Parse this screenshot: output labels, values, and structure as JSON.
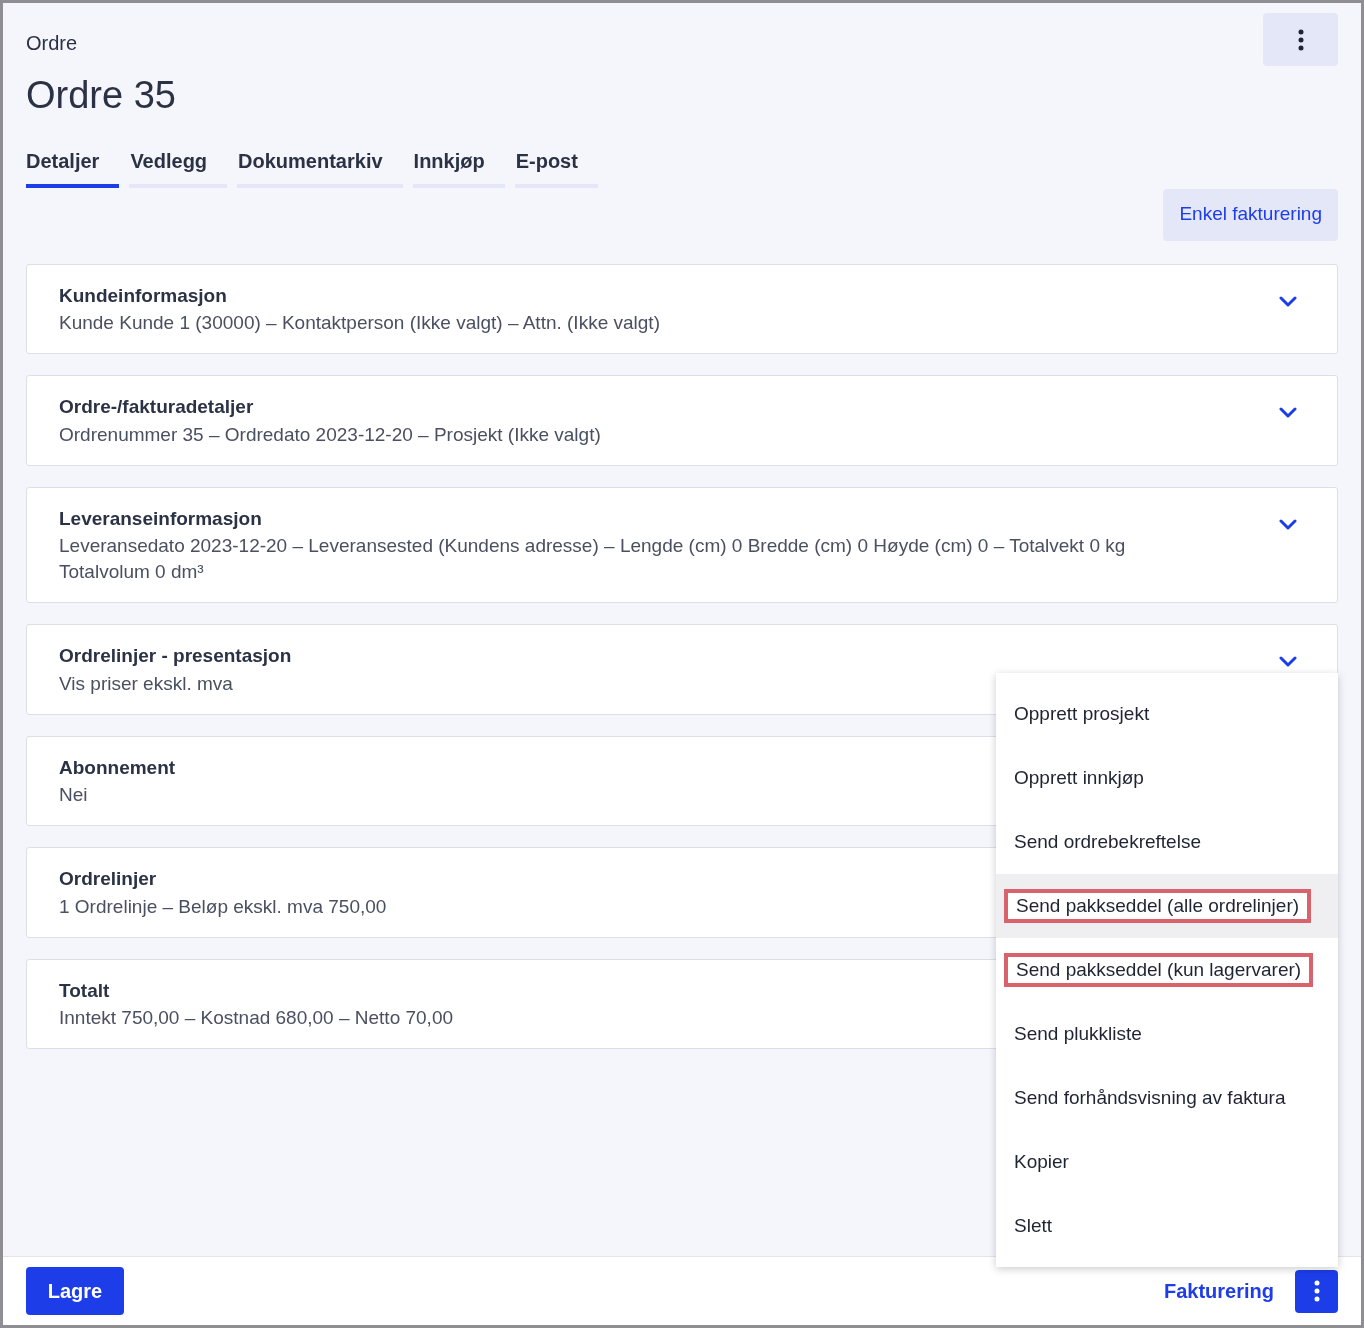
{
  "header": {
    "breadcrumb": "Ordre",
    "title": "Ordre 35"
  },
  "tabs": [
    {
      "label": "Detaljer",
      "selected": true
    },
    {
      "label": "Vedlegg",
      "selected": false
    },
    {
      "label": "Dokumentarkiv",
      "selected": false
    },
    {
      "label": "Innkjøp",
      "selected": false
    },
    {
      "label": "E-post",
      "selected": false
    }
  ],
  "quick_button": "Enkel fakturering",
  "sections": [
    {
      "title": "Kundeinformasjon",
      "summary": "Kunde Kunde 1 (30000) – Kontaktperson (Ikke valgt) – Attn. (Ikke valgt)",
      "expand_icon": true
    },
    {
      "title": "Ordre-/fakturadetaljer",
      "summary": "Ordrenummer 35 – Ordredato 2023-12-20 – Prosjekt (Ikke valgt)",
      "expand_icon": true
    },
    {
      "title": "Leveranseinformasjon",
      "summary": "Leveransedato 2023-12-20 – Leveransested (Kundens adresse) – Lengde (cm) 0 Bredde (cm) 0 Høyde (cm) 0 – Totalvekt 0 kg Totalvolum 0 dm³",
      "expand_icon": true
    },
    {
      "title": "Ordrelinjer - presentasjon",
      "summary": "Vis priser ekskl. mva",
      "expand_icon": true
    },
    {
      "title": "Abonnement",
      "summary": "Nei"
    },
    {
      "title": "Ordrelinjer",
      "summary": "1 Ordrelinje – Beløp ekskl. mva 750,00"
    },
    {
      "title": "Totalt",
      "summary": "Inntekt 750,00 – Kostnad 680,00 – Netto 70,00"
    }
  ],
  "menu": [
    {
      "label": "Opprett prosjekt",
      "hovered": false,
      "marked": false
    },
    {
      "label": "Opprett innkjøp",
      "hovered": false,
      "marked": false
    },
    {
      "label": "Send ordrebekreftelse",
      "hovered": false,
      "marked": false
    },
    {
      "label": "Send pakkseddel (alle ordrelinjer)",
      "hovered": true,
      "marked": true
    },
    {
      "label": "Send pakkseddel (kun lagervarer)",
      "hovered": false,
      "marked": true
    },
    {
      "label": "Send plukkliste",
      "hovered": false,
      "marked": false
    },
    {
      "label": "Send forhåndsvisning av faktura",
      "hovered": false,
      "marked": false
    },
    {
      "label": "Kopier",
      "hovered": false,
      "marked": false
    },
    {
      "label": "Slett",
      "hovered": false,
      "marked": false
    }
  ],
  "footer": {
    "save_button": "Lagre",
    "invoice_link": "Fakturering"
  }
}
